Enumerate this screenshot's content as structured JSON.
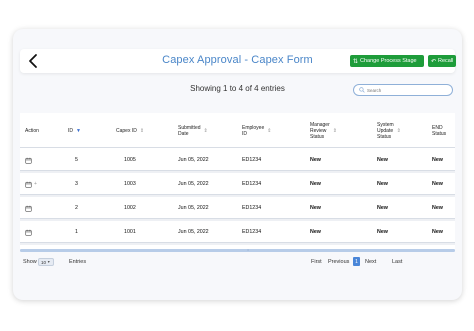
{
  "header": {
    "title": "Capex Approval - Capex Form",
    "change_stage_label": "Change Process Stage",
    "recall_label": "Recall"
  },
  "summary": "Showing 1 to 4 of 4 entries",
  "search": {
    "placeholder": "Search"
  },
  "table": {
    "columns": [
      [
        "Action"
      ],
      [
        "ID"
      ],
      [
        "Capex ID"
      ],
      [
        "Submitted",
        "Date"
      ],
      [
        "Employee",
        "ID"
      ],
      [
        "Manager",
        "Review",
        "Status"
      ],
      [
        "System",
        "Update",
        "Status"
      ],
      [
        "END",
        "Status"
      ]
    ],
    "rows": [
      {
        "id": "5",
        "capex_id": "1005",
        "date": "Jun 05, 2022",
        "employee": "ED1234",
        "manager": "New",
        "system": "New",
        "end": "New"
      },
      {
        "id": "3",
        "capex_id": "1003",
        "date": "Jun 05, 2022",
        "employee": "ED1234",
        "manager": "New",
        "system": "New",
        "end": "New"
      },
      {
        "id": "2",
        "capex_id": "1002",
        "date": "Jun 05, 2022",
        "employee": "ED1234",
        "manager": "New",
        "system": "New",
        "end": "New"
      },
      {
        "id": "1",
        "capex_id": "1001",
        "date": "Jun 05, 2022",
        "employee": "ED1234",
        "manager": "New",
        "system": "New",
        "end": "New"
      }
    ]
  },
  "footer": {
    "show_label": "Show",
    "page_size": "10",
    "entries_label": "Entries",
    "first": "First",
    "previous": "Previous",
    "current_page": "1",
    "next": "Next",
    "last": "Last"
  },
  "colors": {
    "accent": "#4a86c8",
    "button_green": "#1e9c3a",
    "page_active": "#4a86d8"
  },
  "icons": {
    "back": "chevron-left-icon",
    "calendar": "calendar-icon",
    "search": "search-icon"
  }
}
